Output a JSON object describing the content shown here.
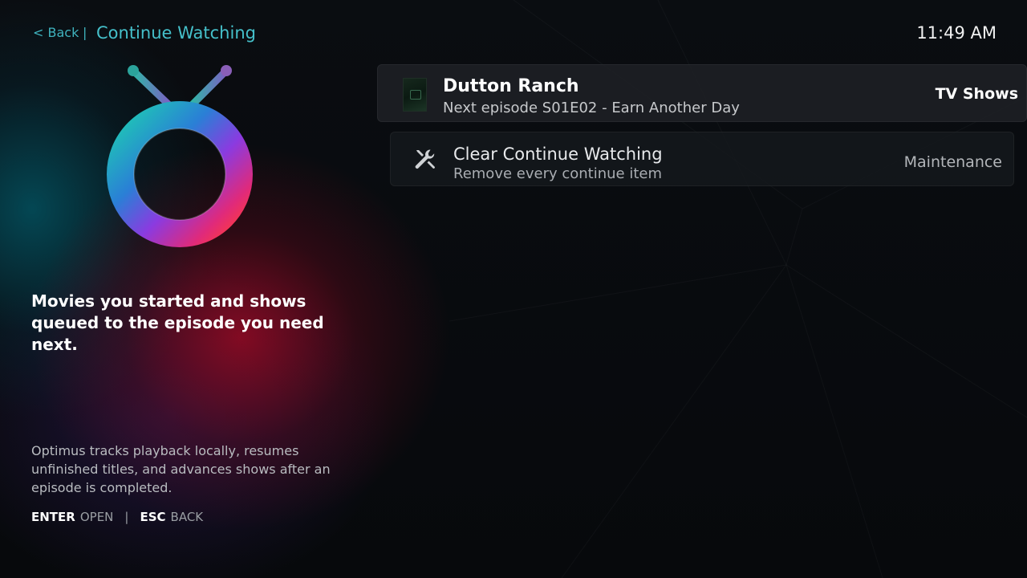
{
  "nav": {
    "back_label": "< Back",
    "separator": "|",
    "title": "Continue Watching"
  },
  "clock": "11:49 AM",
  "intro": {
    "headline": "Movies you started and shows queued to the episode you need next.",
    "footnote": "Optimus tracks playback locally, resumes unfinished titles, and advances shows after an episode is completed."
  },
  "hints": {
    "enter_key": "ENTER",
    "enter_label": "OPEN",
    "separator": "|",
    "esc_key": "ESC",
    "esc_label": "BACK"
  },
  "items": [
    {
      "title": "Dutton Ranch",
      "subtitle": "Next episode S01E02 - Earn Another Day",
      "category": "TV Shows",
      "icon": "poster-thumbnail"
    },
    {
      "title": "Clear Continue Watching",
      "subtitle": "Remove every continue item",
      "category": "Maintenance",
      "icon": "tools-icon"
    }
  ],
  "colors": {
    "accent": "#45c0ca",
    "background": "#06080b",
    "row_focused": "#1e2126",
    "glow_red": "#960a23",
    "glow_teal": "#00788c"
  }
}
